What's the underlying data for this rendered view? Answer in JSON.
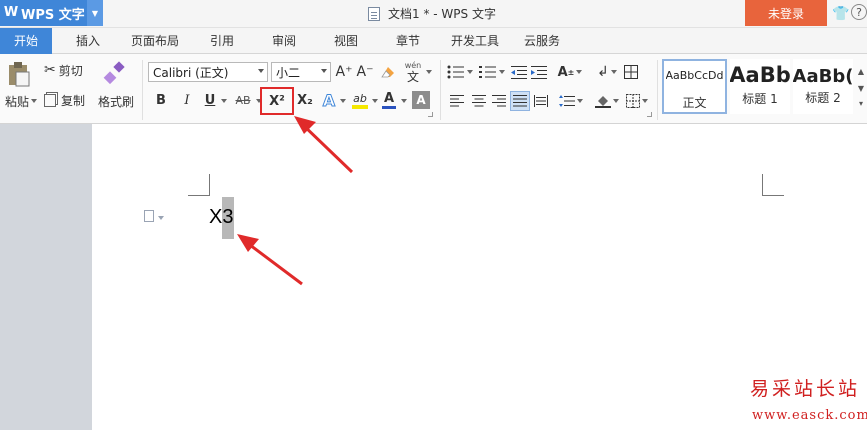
{
  "app": {
    "name": "WPS 文字",
    "logo": "W"
  },
  "window": {
    "title": "文档1 * - WPS 文字",
    "login_label": "未登录",
    "help_label": "?"
  },
  "tabs": [
    {
      "label": "开始",
      "active": true
    },
    {
      "label": "插入"
    },
    {
      "label": "页面布局"
    },
    {
      "label": "引用"
    },
    {
      "label": "审阅"
    },
    {
      "label": "视图"
    },
    {
      "label": "章节"
    },
    {
      "label": "开发工具"
    },
    {
      "label": "云服务"
    }
  ],
  "clipboard": {
    "paste_label": "粘贴",
    "cut_label": "剪切",
    "copy_label": "复制",
    "format_painter_label": "格式刷"
  },
  "font": {
    "family": "Calibri (正文)",
    "size": "小二",
    "grow_label": "A⁺",
    "shrink_label": "A⁻",
    "bold_label": "B",
    "italic_label": "I",
    "underline_label": "U",
    "strike_label": "AB",
    "superscript_label": "X²",
    "subscript_label": "X₂",
    "effect_label": "A",
    "highlight_label": "ab",
    "color_label": "A",
    "shade_label": "A",
    "pinyin_top": "wén",
    "pinyin_char": "文"
  },
  "styles": [
    {
      "sample": "AaBbCcDd",
      "label": "正文",
      "selected": true
    },
    {
      "sample": "AaBb",
      "label": "标题 1"
    },
    {
      "sample": "AaBb(",
      "label": "标题 2"
    }
  ],
  "document": {
    "text": "X3"
  },
  "watermark": {
    "name": "易采站长站",
    "url": "www.easck.com"
  },
  "colors": {
    "accent": "#3f86d8",
    "login": "#e8643c",
    "annotation": "#e02a2a"
  }
}
